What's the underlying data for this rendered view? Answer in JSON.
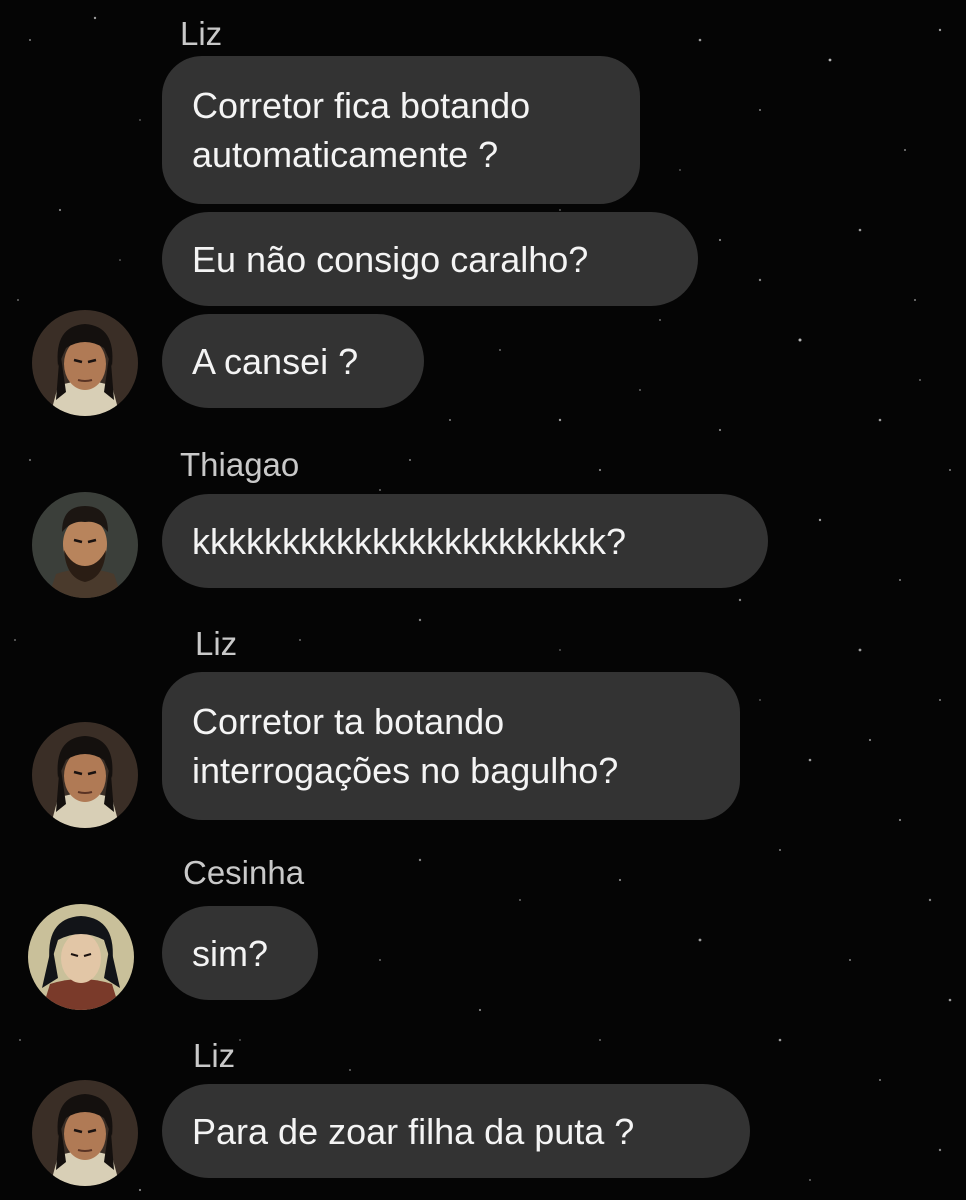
{
  "chat": {
    "groups": [
      {
        "sender": "Liz",
        "avatar_icon": "liz-avatar",
        "messages": [
          "Corretor fica botando\nautomaticamente ?",
          "Eu não consigo caralho?",
          "A cansei ?"
        ]
      },
      {
        "sender": "Thiagao",
        "avatar_icon": "thiagao-avatar",
        "messages": [
          "kkkkkkkkkkkkkkkkkkkkkkk?"
        ]
      },
      {
        "sender": "Liz",
        "avatar_icon": "liz-avatar",
        "messages": [
          "Corretor ta botando\ninterrogações no bagulho?"
        ]
      },
      {
        "sender": "Cesinha",
        "avatar_icon": "cesinha-avatar",
        "messages": [
          "sim?"
        ]
      },
      {
        "sender": "Liz",
        "avatar_icon": "liz-avatar",
        "messages": [
          "Para de zoar filha da puta ?"
        ]
      }
    ]
  },
  "colors": {
    "background": "#050505",
    "bubble": "#333333",
    "message_text": "#f4f4f4",
    "sender_text": "#c9c9c9"
  }
}
